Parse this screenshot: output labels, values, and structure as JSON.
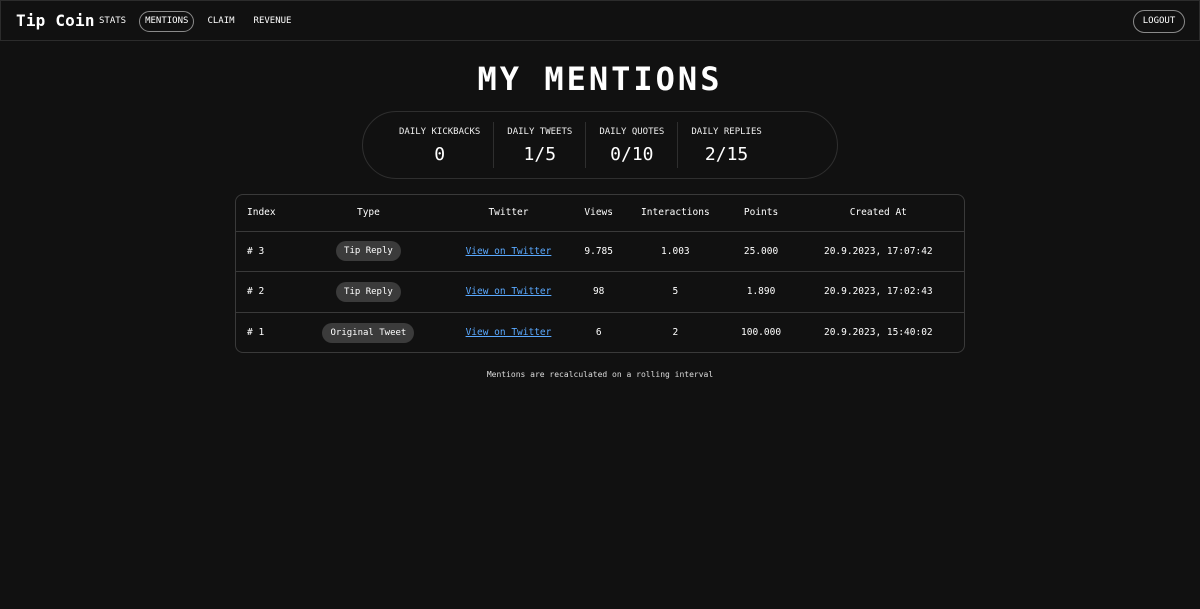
{
  "nav": {
    "brand": "Tip Coin",
    "links": [
      {
        "label": "STATS",
        "active": false
      },
      {
        "label": "MENTIONS",
        "active": true
      },
      {
        "label": "CLAIM",
        "active": false
      },
      {
        "label": "REVENUE",
        "active": false
      }
    ],
    "logout_label": "LOGOUT"
  },
  "page": {
    "title": "MY MENTIONS"
  },
  "stats": [
    {
      "label": "DAILY KICKBACKS",
      "value": "0"
    },
    {
      "label": "DAILY TWEETS",
      "value": "1/5"
    },
    {
      "label": "DAILY QUOTES",
      "value": "0/10"
    },
    {
      "label": "DAILY REPLIES",
      "value": "2/15"
    }
  ],
  "table": {
    "headers": [
      "Index",
      "Type",
      "Twitter",
      "Views",
      "Interactions",
      "Points",
      "Created At"
    ],
    "rows": [
      {
        "index": "# 3",
        "type": "Tip Reply",
        "twitter": "View on Twitter",
        "views": "9.785",
        "interactions": "1.003",
        "points": "25.000",
        "created": "20.9.2023, 17:07:42"
      },
      {
        "index": "# 2",
        "type": "Tip Reply",
        "twitter": "View on Twitter",
        "views": "98",
        "interactions": "5",
        "points": "1.890",
        "created": "20.9.2023, 17:02:43"
      },
      {
        "index": "# 1",
        "type": "Original Tweet",
        "twitter": "View on Twitter",
        "views": "6",
        "interactions": "2",
        "points": "100.000",
        "created": "20.9.2023, 15:40:02"
      }
    ]
  },
  "footnote": "Mentions are recalculated on a rolling interval"
}
